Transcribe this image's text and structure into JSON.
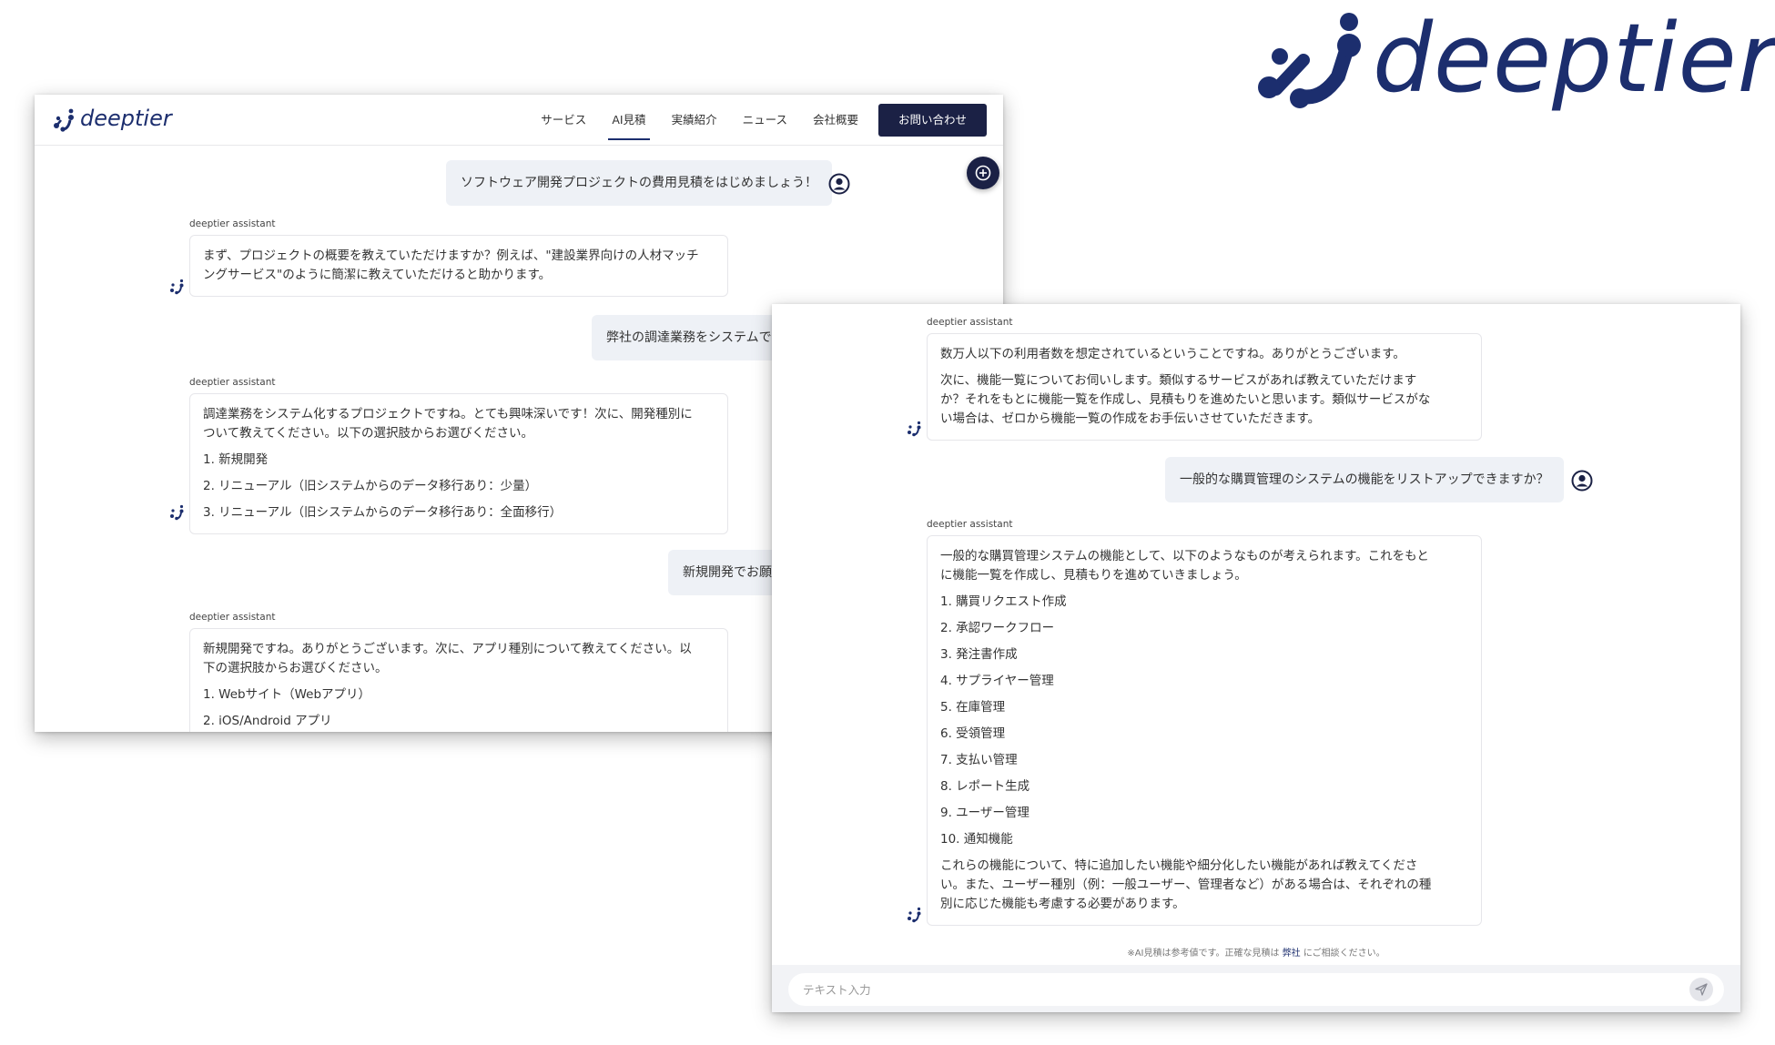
{
  "brand": {
    "name": "deeptier",
    "accent": "#1c2e6e",
    "dark": "#1b2145"
  },
  "nav": {
    "links": [
      "サービス",
      "AI見積",
      "実績紹介",
      "ニュース",
      "会社概要"
    ],
    "active": "AI見積",
    "cta": "お問い合わせ"
  },
  "window1": {
    "assistant_label": "deeptier assistant",
    "msg1_user": "ソフトウェア開発プロジェクトの費用見積をはじめましょう！",
    "msg2_assistant": [
      "まず、プロジェクトの概要を教えていただけますか？例えば、\"建設業界向けの人材マッチ",
      "ングサービス\"のように簡潔に教えていただけると助かります。"
    ],
    "msg3_user": "弊社の調達業務をシステムで構",
    "msg4_assistant": {
      "lines": [
        "調達業務をシステム化するプロジェクトですね。とても興味深いです！次に、開発種別に",
        "ついて教えてください。以下の選択肢からお選びください。"
      ],
      "options": [
        "1. 新規開発",
        "2. リニューアル（旧システムからのデータ移行あり：少量）",
        "3. リニューアル（旧システムからのデータ移行あり：全面移行）"
      ]
    },
    "msg5_user": "新規開発でお願",
    "msg6_assistant": {
      "lines": [
        "新規開発ですね。ありがとうございます。次に、アプリ種別について教えてください。以",
        "下の選択肢からお選びください。"
      ],
      "options": [
        "1. Webサイト（Webアプリ）",
        "2. iOS/Android アプリ"
      ]
    }
  },
  "window2": {
    "assistant_label": "deeptier assistant",
    "msg1_assistant": {
      "line1": "数万人以下の利用者数を想定されているということですね。ありがとうございます。",
      "lines": [
        "次に、機能一覧についてお伺いします。類似するサービスがあれば教えていただけます",
        "か？それをもとに機能一覧を作成し、見積もりを進めたいと思います。類似サービスがな",
        "い場合は、ゼロから機能一覧の作成をお手伝いさせていただきます。"
      ]
    },
    "msg2_user": "一般的な購買管理のシステムの機能をリストアップできますか？",
    "msg3_assistant": {
      "intro": [
        "一般的な購買管理システムの機能として、以下のようなものが考えられます。これをもと",
        "に機能一覧を作成し、見積もりを進めていきましょう。"
      ],
      "items": [
        "1. 購買リクエスト作成",
        "2. 承認ワークフロー",
        "3. 発注書作成",
        "4. サプライヤー管理",
        "5. 在庫管理",
        "6. 受領管理",
        "7. 支払い管理",
        "8. レポート生成",
        "9. ユーザー管理",
        "10. 通知機能"
      ],
      "outro": [
        "これらの機能について、特に追加したい機能や細分化したい機能があれば教えてくださ",
        "い。また、ユーザー種別（例：一般ユーザー、管理者など）がある場合は、それぞれの種",
        "別に応じた機能も考慮する必要があります。"
      ]
    },
    "disclaimer": {
      "before": "※AI見積は参考値です。正確な見積は ",
      "link": "弊社",
      "after": " にご相談ください。"
    },
    "input_placeholder": "テキスト入力"
  }
}
